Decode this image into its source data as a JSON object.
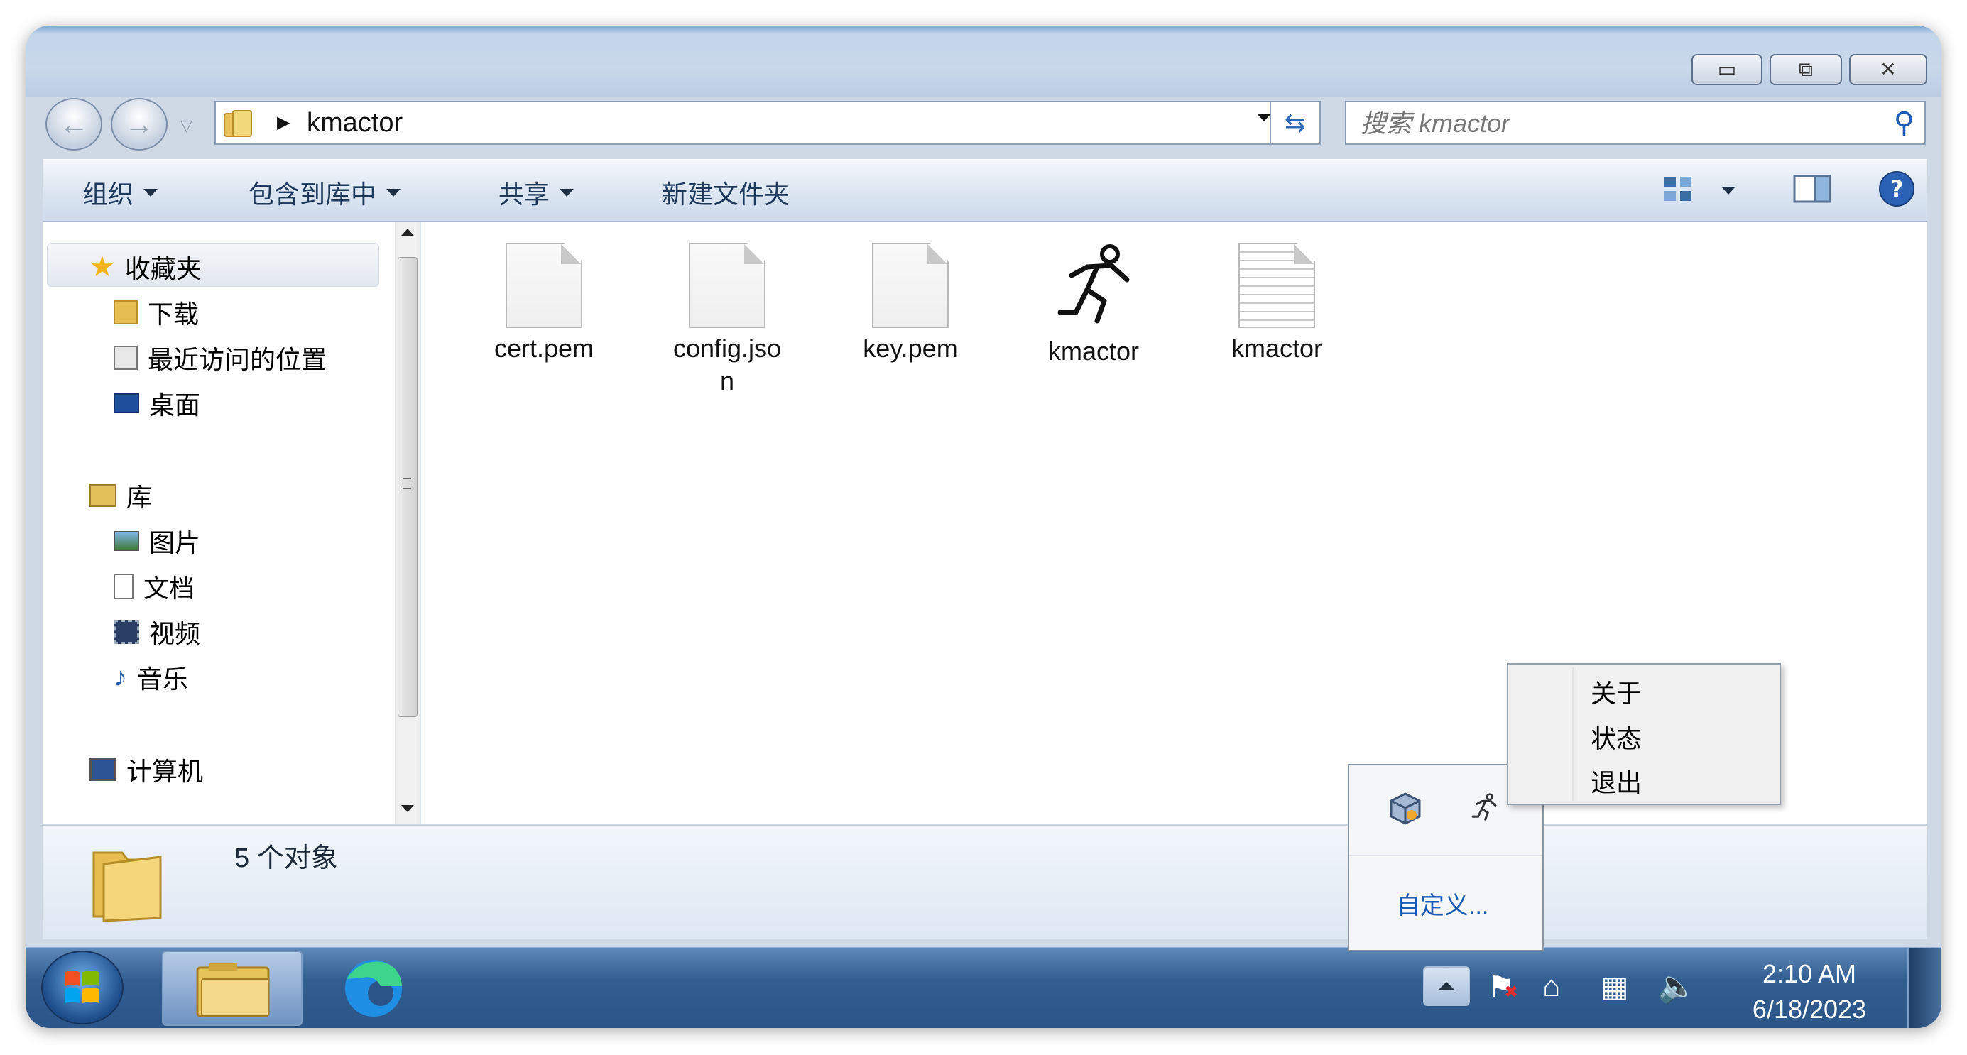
{
  "window": {
    "address": {
      "path": "kmactor"
    },
    "search": {
      "placeholder": "搜索 kmactor"
    }
  },
  "toolbar": {
    "organize": "组织",
    "include_in_library": "包含到库中",
    "share": "共享",
    "new_folder": "新建文件夹"
  },
  "sidebar": {
    "favorites": {
      "label": "收藏夹",
      "items": [
        {
          "label": "下载"
        },
        {
          "label": "最近访问的位置"
        },
        {
          "label": "桌面"
        }
      ]
    },
    "libraries": {
      "label": "库",
      "items": [
        {
          "label": "图片"
        },
        {
          "label": "文档"
        },
        {
          "label": "视频"
        },
        {
          "label": "音乐"
        }
      ]
    },
    "computer": {
      "label": "计算机"
    }
  },
  "files": [
    {
      "name": "cert.pem",
      "icon": "blank-file-icon"
    },
    {
      "name": "config.json",
      "line1": "config.jso",
      "line2": "n",
      "icon": "blank-file-icon"
    },
    {
      "name": "key.pem",
      "icon": "blank-file-icon"
    },
    {
      "name": "kmactor",
      "icon": "running-man-icon"
    },
    {
      "name": "kmactor",
      "icon": "text-file-icon"
    }
  ],
  "status": {
    "count_text": "5 个对象"
  },
  "tray_popup": {
    "customize": "自定义..."
  },
  "context_menu": {
    "items": [
      {
        "label": "关于"
      },
      {
        "label": "状态"
      },
      {
        "label": "退出"
      }
    ]
  },
  "taskbar": {
    "time": "2:10 AM",
    "date": "6/18/2023"
  },
  "colors": {
    "accent": "#1e395b",
    "taskbar": "#2b5588",
    "link": "#1a5bb5"
  }
}
